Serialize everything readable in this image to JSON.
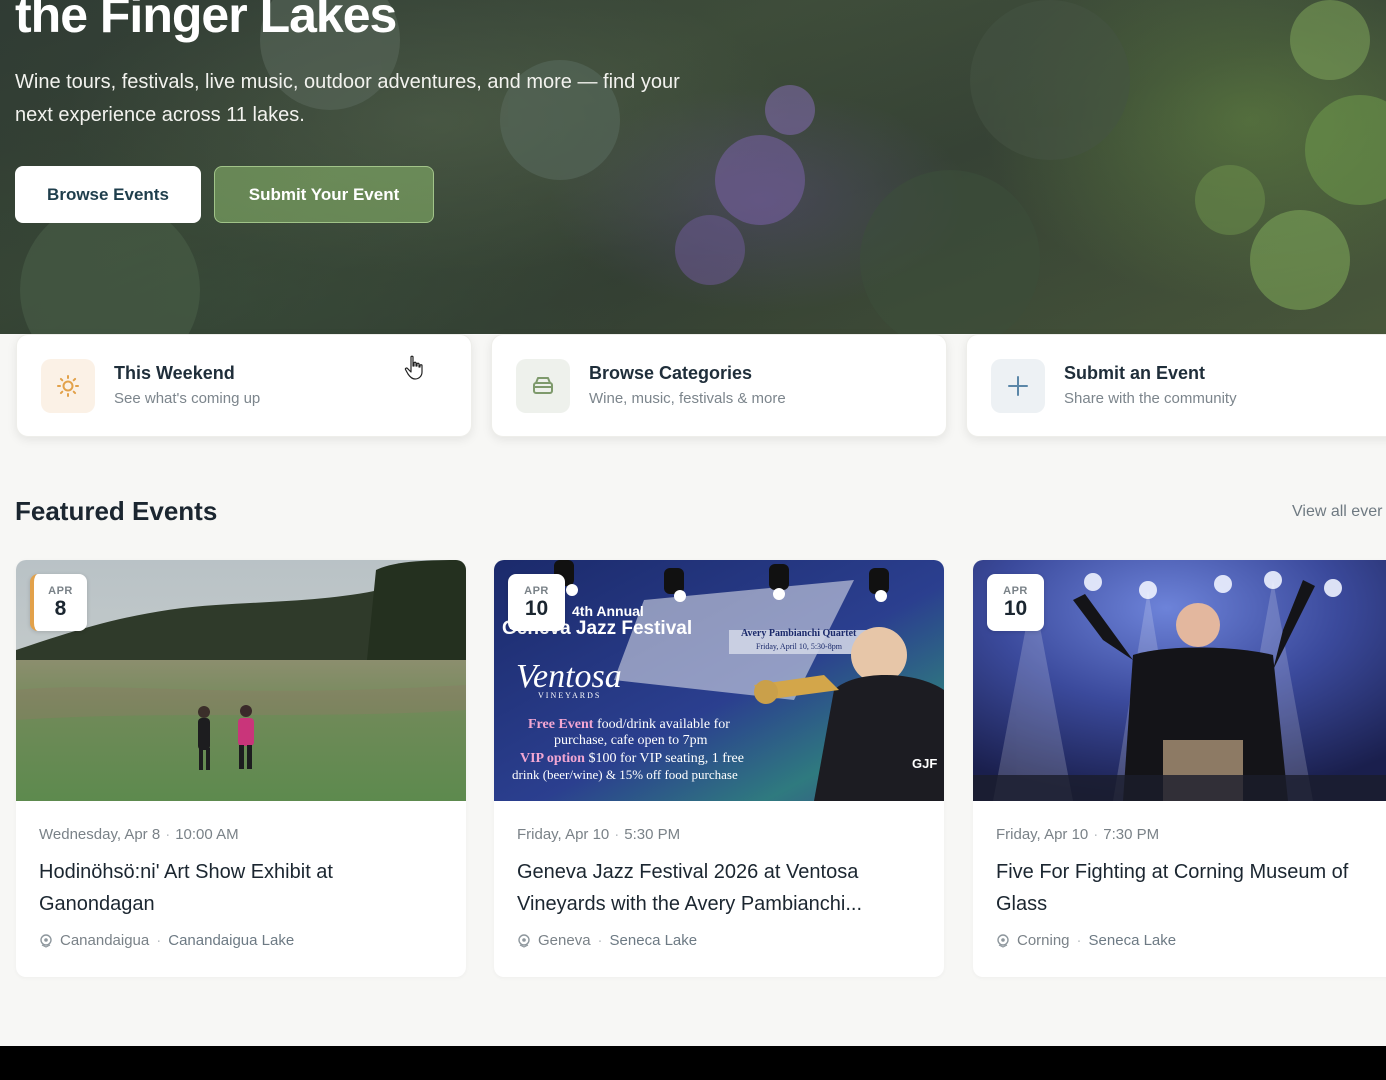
{
  "hero": {
    "title": "the Finger Lakes",
    "subtitle": "Wine tours, festivals, live music, outdoor adventures, and more — find your next experience across 11 lakes.",
    "browse_label": "Browse Events",
    "submit_label": "Submit Your Event"
  },
  "quick_links": [
    {
      "title": "This Weekend",
      "subtitle": "See what's coming up",
      "icon": "sun-icon"
    },
    {
      "title": "Browse Categories",
      "subtitle": "Wine, music, festivals & more",
      "icon": "wine-glass-icon"
    },
    {
      "title": "Submit an Event",
      "subtitle": "Share with the community",
      "icon": "plus-icon"
    }
  ],
  "featured": {
    "title": "Featured Events",
    "view_all": "View all ever"
  },
  "events": [
    {
      "month": "APR",
      "day": "8",
      "weekday_date": "Wednesday, Apr 8",
      "time": "10:00 AM",
      "title": "Hodinöhsö:ni' Art Show Exhibit at Ganondagan",
      "town": "Canandaigua",
      "lake": "Canandaigua Lake"
    },
    {
      "month": "APR",
      "day": "10",
      "weekday_date": "Friday, Apr 10",
      "time": "5:30 PM",
      "title": "Geneva Jazz Festival 2026 at Ventosa Vineyards with the Avery Pambianchi...",
      "town": "Geneva",
      "lake": "Seneca Lake",
      "image_text": {
        "annual": "4th Annual",
        "festival": "Geneva Jazz Festival",
        "quartet": "Avery Pambianchi Quartet",
        "quartet_date": "Friday, April 10, 5:30-8pm",
        "logo": "Ventosa",
        "logo_sub": "VINEYARDS",
        "line1a": "Free Event",
        "line1b": " food/drink available for",
        "line2": "purchase, cafe open to 7pm",
        "line3a": "VIP option",
        "line3b": " $100 for VIP seating, 1 free",
        "line4": "drink (beer/wine) & 15% off food purchase",
        "badge": "GJF"
      }
    },
    {
      "month": "APR",
      "day": "10",
      "weekday_date": "Friday, Apr 10",
      "time": "7:30 PM",
      "title": "Five For Fighting at Corning Museum of Glass",
      "town": "Corning",
      "lake": "Seneca Lake"
    }
  ],
  "colors": {
    "brand_dark": "#1f3e4c",
    "accent_green": "#8cb96e",
    "accent_orange": "#e2a14a",
    "muted_text": "#7a8288"
  }
}
